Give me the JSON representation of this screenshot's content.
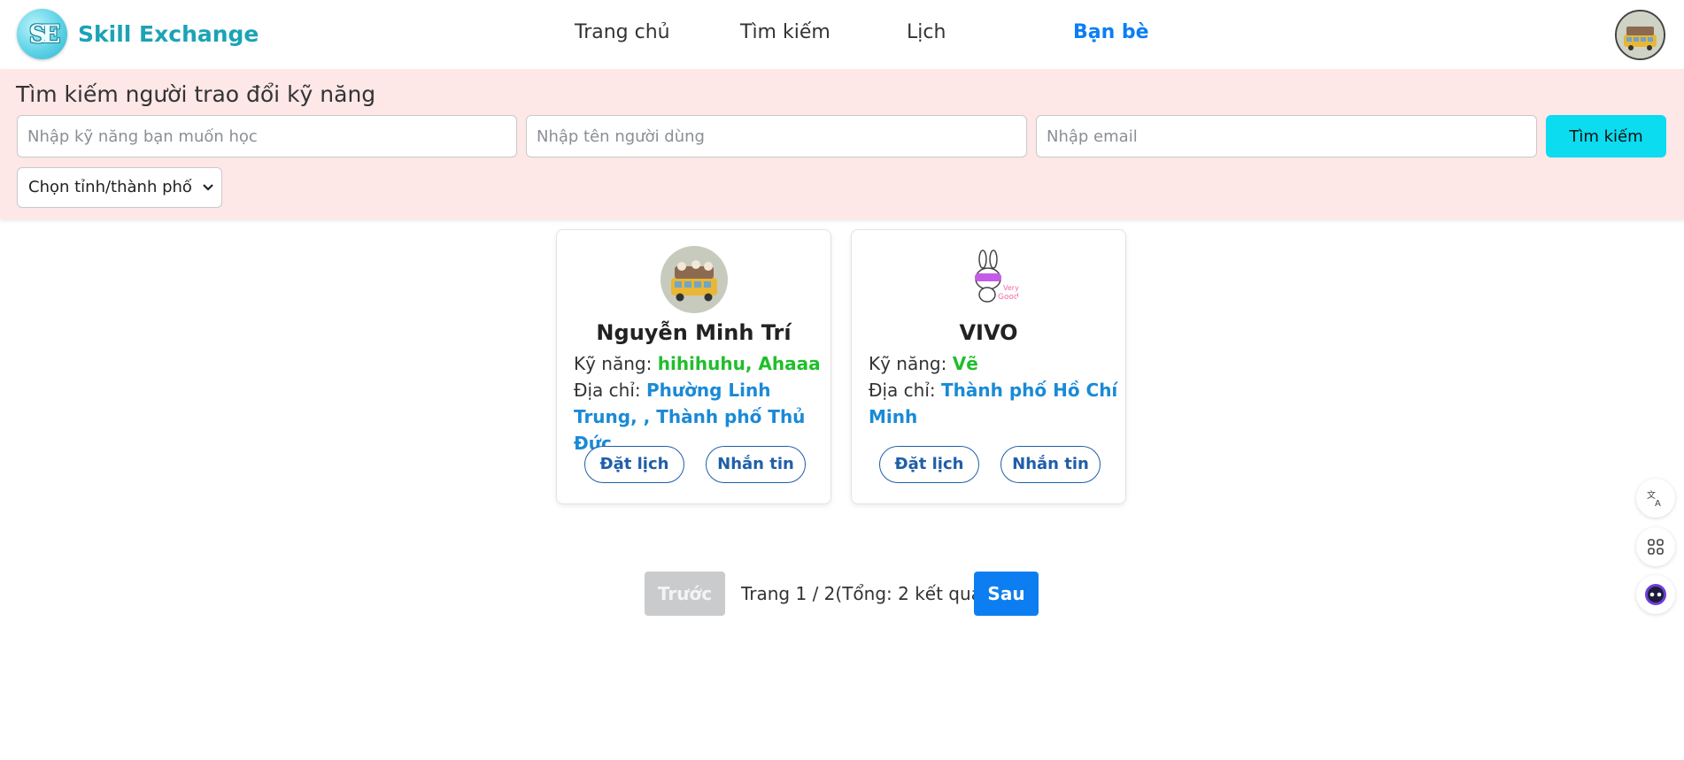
{
  "header": {
    "logo_letters": "SE",
    "brand": "Skill Exchange",
    "nav": [
      {
        "label": "Trang chủ"
      },
      {
        "label": "Tìm kiếm"
      },
      {
        "label": "Lịch"
      },
      {
        "label": "Bạn bè",
        "active": true
      }
    ]
  },
  "search": {
    "title": "Tìm kiếm người trao đổi kỹ năng",
    "skill_placeholder": "Nhập kỹ năng bạn muốn học",
    "name_placeholder": "Nhập tên người dùng",
    "email_placeholder": "Nhập email",
    "button": "Tìm kiếm",
    "city_selected": "Chọn tỉnh/thành phố"
  },
  "cards": [
    {
      "name": "Nguyễn Minh Trí",
      "skill_label": "Kỹ năng:",
      "skills": "hihihuhu, Ahaaa",
      "address_label": "Địa chỉ:",
      "address": "Phường Linh Trung, , Thành phố Thủ Đức",
      "book_label": "Đặt lịch",
      "message_label": "Nhắn tin"
    },
    {
      "name": "VIVO",
      "skill_label": "Kỹ năng:",
      "skills": "Vẽ",
      "address_label": "Địa chỉ:",
      "address": "Thành phố Hồ Chí Minh",
      "book_label": "Đặt lịch",
      "message_label": "Nhắn tin"
    }
  ],
  "pagination": {
    "prev": "Trước",
    "info": "Trang 1 / 2(Tổng: 2 kết quả)",
    "next": "Sau"
  },
  "colors": {
    "brand": "#1ba3b5",
    "active_nav": "#0d7ef2",
    "search_bg": "#fde7e7",
    "search_button": "#0bdcf0",
    "skill": "#1fbf2a",
    "address": "#1a8ad6",
    "pill": "#1f5ea8"
  },
  "icons": [
    "translate-icon",
    "apps-icon",
    "assistant-icon"
  ]
}
